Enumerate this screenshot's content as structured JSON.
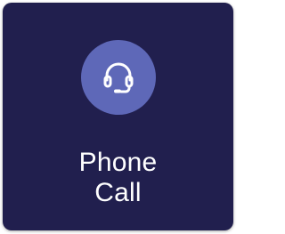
{
  "tile": {
    "label_line1": "Phone",
    "label_line2": "Call",
    "icon": "headset-icon",
    "colors": {
      "background": "#211f4e",
      "icon_circle": "#5e68b8",
      "text": "#ffffff"
    }
  }
}
